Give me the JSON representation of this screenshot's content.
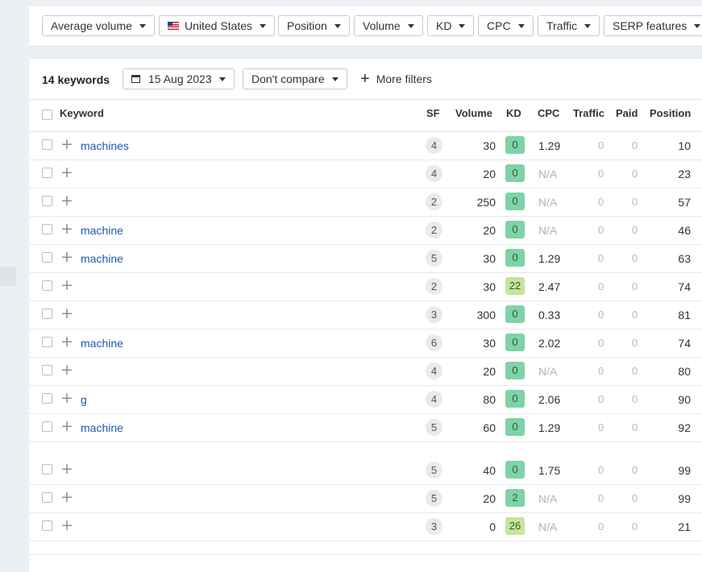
{
  "filters": [
    {
      "label": "Average volume"
    },
    {
      "label": "United States",
      "icon": "us-flag-icon"
    },
    {
      "label": "Position"
    },
    {
      "label": "Volume"
    },
    {
      "label": "KD"
    },
    {
      "label": "CPC"
    },
    {
      "label": "Traffic"
    },
    {
      "label": "SERP features"
    }
  ],
  "toolbar": {
    "count": "14 keywords",
    "date": "15 Aug 2023",
    "compare": "Don't compare",
    "more_filters": "More filters"
  },
  "columns": {
    "keyword": "Keyword",
    "sf": "SF",
    "volume": "Volume",
    "kd": "KD",
    "cpc": "CPC",
    "traffic": "Traffic",
    "paid": "Paid",
    "position": "Position"
  },
  "rows": [
    {
      "keyword": "machines",
      "sf": "4",
      "volume": "30",
      "kd": "0",
      "cpc": "1.29",
      "traffic": "0",
      "paid": "0",
      "position": "10"
    },
    {
      "keyword": "",
      "sf": "4",
      "volume": "20",
      "kd": "0",
      "cpc": "N/A",
      "traffic": "0",
      "paid": "0",
      "position": "23"
    },
    {
      "keyword": "",
      "sf": "2",
      "volume": "250",
      "kd": "0",
      "cpc": "N/A",
      "traffic": "0",
      "paid": "0",
      "position": "57"
    },
    {
      "keyword": "machine",
      "sf": "2",
      "volume": "20",
      "kd": "0",
      "cpc": "N/A",
      "traffic": "0",
      "paid": "0",
      "position": "46"
    },
    {
      "keyword": "machine",
      "sf": "5",
      "volume": "30",
      "kd": "0",
      "cpc": "1.29",
      "traffic": "0",
      "paid": "0",
      "position": "63"
    },
    {
      "keyword": "",
      "sf": "2",
      "volume": "30",
      "kd": "22",
      "cpc": "2.47",
      "traffic": "0",
      "paid": "0",
      "position": "74"
    },
    {
      "keyword": "",
      "sf": "3",
      "volume": "300",
      "kd": "0",
      "cpc": "0.33",
      "traffic": "0",
      "paid": "0",
      "position": "81"
    },
    {
      "keyword": "machine",
      "sf": "6",
      "volume": "30",
      "kd": "0",
      "cpc": "2.02",
      "traffic": "0",
      "paid": "0",
      "position": "74"
    },
    {
      "keyword": "",
      "sf": "4",
      "volume": "20",
      "kd": "0",
      "cpc": "N/A",
      "traffic": "0",
      "paid": "0",
      "position": "80"
    },
    {
      "keyword": "g",
      "sf": "4",
      "volume": "80",
      "kd": "0",
      "cpc": "2.06",
      "traffic": "0",
      "paid": "0",
      "position": "90"
    },
    {
      "keyword": "machine",
      "sf": "5",
      "volume": "60",
      "kd": "0",
      "cpc": "1.29",
      "traffic": "0",
      "paid": "0",
      "position": "92"
    },
    {
      "keyword": "",
      "sf": "5",
      "volume": "40",
      "kd": "0",
      "cpc": "1.75",
      "traffic": "0",
      "paid": "0",
      "position": "99"
    },
    {
      "keyword": "",
      "sf": "5",
      "volume": "20",
      "kd": "2",
      "cpc": "N/A",
      "traffic": "0",
      "paid": "0",
      "position": "99"
    },
    {
      "keyword": "",
      "sf": "3",
      "volume": "0",
      "kd": "26",
      "cpc": "N/A",
      "traffic": "0",
      "paid": "0",
      "position": "21"
    }
  ],
  "colors": {
    "kd_easy": "#7fd3a6",
    "kd_mid": "#c6e59a",
    "link": "#1a5aa8"
  }
}
